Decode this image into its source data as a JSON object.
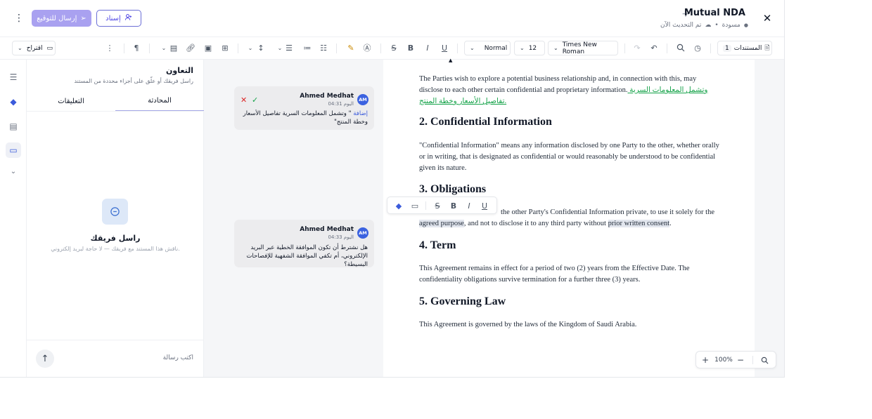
{
  "header": {
    "doc_title": "Mutual NDA",
    "status": "مسودة",
    "updated": "تم التحديث الآن",
    "assign_label": "إسناد",
    "send_label": "إرسال للتوقيع"
  },
  "toolbar": {
    "documents_label": "المستندات",
    "documents_count": "1",
    "font_family": "Times New Roman",
    "font_size": "12",
    "style": "Normal",
    "suggest_label": "اقتراح"
  },
  "collab": {
    "title": "التعاون",
    "subtitle": "راسل فريقك أو علّق على أجزاء محددة من المستند",
    "tab_chat": "المحادثة",
    "tab_comments": "التعليقات",
    "empty_title": "راسل فريقك",
    "empty_subtitle": "ناقش هذا المستند مع فريقك — لا حاجة لبريد إلكتروني.",
    "composer_placeholder": "اكتب رسالة"
  },
  "comments": [
    {
      "initials": "AM",
      "author": "Ahmed Medhat",
      "time": "اليوم 04:31",
      "tag": "إضافة",
      "body": "\" وتشمل المعلومات السرية تفاصيل الأسعار وخطة المنتج\""
    },
    {
      "initials": "AM",
      "author": "Ahmed Medhat",
      "time": "اليوم 04:33",
      "body": "هل نشترط أن تكون الموافقة الخطية عبر البريد الإلكتروني، أم تكفي الموافقة الشفهية للإفصاحات البسيطة؟"
    }
  ],
  "document": {
    "p1": "The Parties wish to explore a potential business relationship and, in connection with this, may disclose to each other certain confidential and proprietary information.",
    "p1_insert": " وتشمل المعلومات السرية تفاصيل الأسعار وخطة المنتج.",
    "h2": "2. Confidential Information",
    "p2": "\"Confidential Information\" means any information disclosed by one Party to the other, whether orally or in writing, that is designated as confidential or would reasonably be understood to be confidential given its nature.",
    "h3": "3. Obligations",
    "p3a": "the other Party's Confidential Information private, to use it solely for the",
    "p3b": "agreed purpose",
    "p3c": ", and not to disclose it to any third party without ",
    "p3d": "prior written consent",
    "p3e": ".",
    "h4": "4. Term",
    "p4": "This Agreement remains in effect for a period of two (2) years from the Effective Date. The confidentiality obligations survive termination for a further three (3) years.",
    "h5": "5. Governing Law",
    "p5": "This Agreement is governed by the laws of the Kingdom of Saudi Arabia."
  },
  "zoom": {
    "level": "100%"
  },
  "colors": {
    "accent": "#4f46e5",
    "send_button": "#a9a1f0",
    "insertion": "#16a34a",
    "reject": "#dc2626",
    "avatar": "#3b62e0"
  }
}
